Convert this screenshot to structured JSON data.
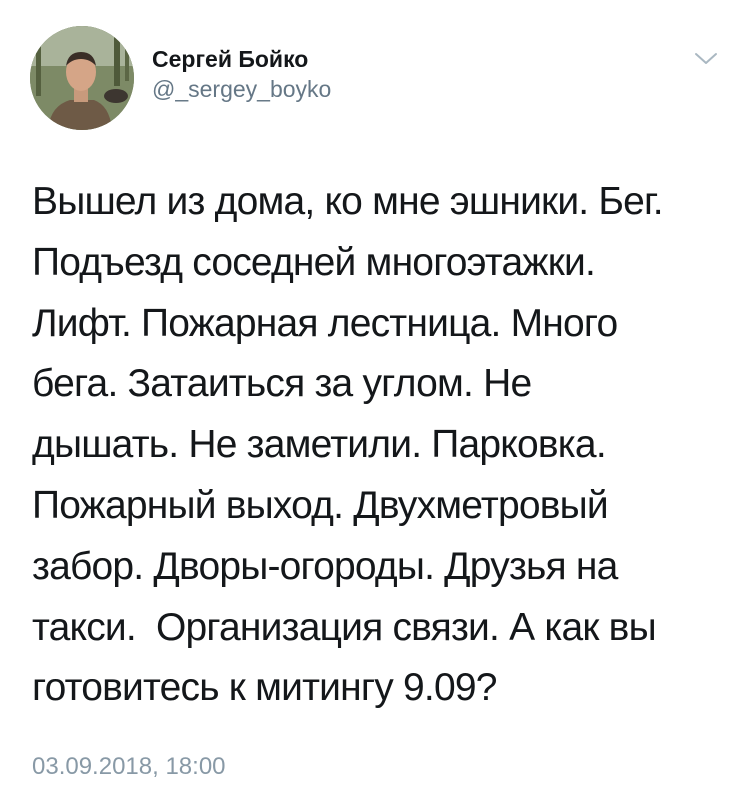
{
  "author": {
    "display_name": "Сергей Бойко",
    "handle": "@_sergey_boyko"
  },
  "icons": {
    "menu": "chevron-down-icon",
    "avatar": "user-avatar-photo"
  },
  "tweet": {
    "lines": [
      "Вышел из дома, ко мне эшники. Бег.",
      "Подъезд соседней многоэтажки.",
      "Лифт. Пожарная лестница. Много",
      "бега. Затаиться за углом. Не",
      "дышать. Не заметили. Парковка.",
      "Пожарный выход. Двухметровый",
      "забор. Дворы-огороды. Друзья на",
      "такси.  Организация связи. А как вы",
      "готовитесь к митингу 9.09?"
    ],
    "timestamp": "03.09.2018, 18:00"
  },
  "colors": {
    "text": "#14171a",
    "secondary": "#657786",
    "timestamp": "#8899a6",
    "chevron": "#aab8c2"
  }
}
